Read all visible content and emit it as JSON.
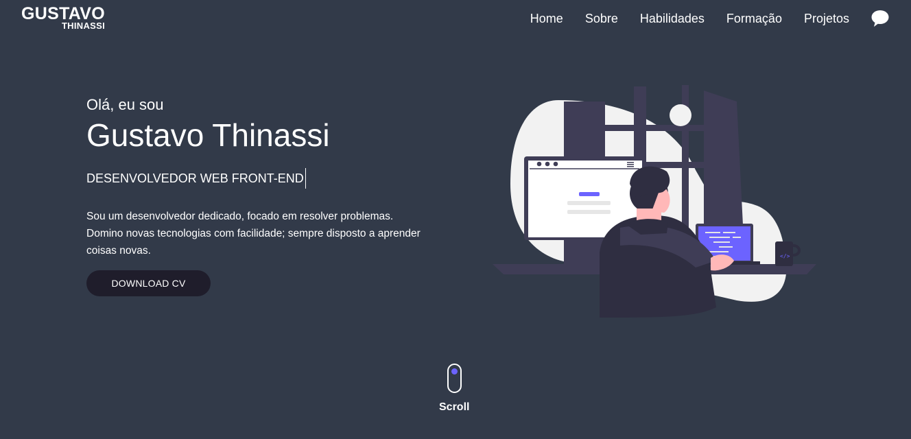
{
  "logo": {
    "main": "GUSTAVO",
    "sub": "THINASSI"
  },
  "nav": {
    "items": [
      {
        "label": "Home"
      },
      {
        "label": "Sobre"
      },
      {
        "label": "Habilidades"
      },
      {
        "label": "Formação"
      },
      {
        "label": "Projetos"
      }
    ],
    "contact_icon": "chat-bubble-icon"
  },
  "hero": {
    "greeting": "Olá, eu sou",
    "name": "Gustavo Thinassi",
    "role": "DESENVOLVEDOR WEB FRONT-END",
    "description_line1": "Sou um desenvolvedor dedicado, focado em resolver problemas.",
    "description_line2": "Domino novas tecnologias com facilidade; sempre disposto a aprender",
    "description_line3": "coisas novas.",
    "cv_button": "DOWNLOAD CV"
  },
  "illustration": {
    "name": "developer-at-desk-illustration",
    "laptop_code_icon": "code-icon"
  },
  "scroll": {
    "label": "Scroll",
    "icon": "mouse-scroll-icon"
  },
  "colors": {
    "background": "#323a49",
    "accent": "#6c63ff",
    "button_bg": "#1f1d2b",
    "text": "#ffffff"
  }
}
